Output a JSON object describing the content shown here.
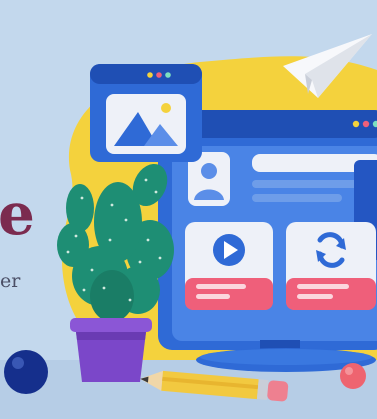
{
  "text": {
    "headline_fragment": "e",
    "subline_fragment": "er"
  },
  "palette": {
    "background": "#c2d8ee",
    "blob_yellow": "#f4d23d",
    "window_blue": "#2f6ad6",
    "window_blue_dark": "#1f4fb4",
    "card_white": "#eef1f8",
    "accent_pink": "#ef5f7a",
    "cactus_green": "#1e8e74",
    "pot_purple": "#7b47c9",
    "headline_color": "#7b2b4f",
    "subtext_color": "#4b4f66",
    "ball_navy": "#152f8c",
    "ball_coral": "#ee6470",
    "pencil_yellow": "#f2c940"
  },
  "icons": [
    "image-icon",
    "play-icon",
    "refresh-icon",
    "paper-plane-icon",
    "avatar-icon"
  ]
}
